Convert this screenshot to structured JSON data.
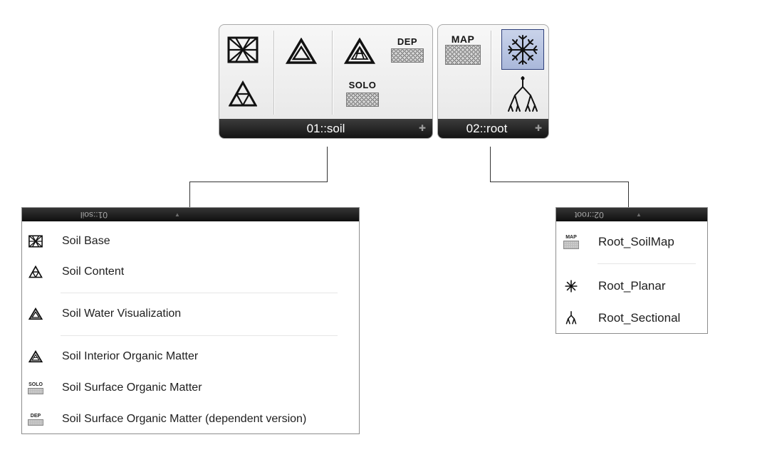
{
  "toolbar": {
    "soil_tab": {
      "title": "01::soil",
      "arrow": "✚",
      "labels": {
        "dep": "DEP",
        "solo": "SOLO"
      }
    },
    "root_tab": {
      "title": "02::root",
      "arrow": "✚",
      "labels": {
        "map": "MAP"
      }
    }
  },
  "soil_menu": {
    "header": "01::soil",
    "header_arrow": "▲",
    "items": [
      {
        "label": "Soil Base",
        "icon": "soil-base-icon"
      },
      {
        "label": "Soil Content",
        "icon": "soil-content-icon"
      },
      {
        "label": "Soil Water Visualization",
        "icon": "soil-water-icon"
      },
      {
        "label": "Soil Interior Organic Matter",
        "icon": "soil-interior-icon"
      },
      {
        "label": "Soil Surface Organic Matter",
        "icon": "solo-icon",
        "icon_text": "SOLO"
      },
      {
        "label": "Soil Surface Organic Matter (dependent version)",
        "icon": "dep-icon",
        "icon_text": "DEP"
      }
    ]
  },
  "root_menu": {
    "header": "02::root",
    "header_arrow": "▲",
    "items": [
      {
        "label": "Root_SoilMap",
        "icon": "map-icon",
        "icon_text": "MAP"
      },
      {
        "label": "Root_Planar",
        "icon": "planar-root-icon"
      },
      {
        "label": "Root_Sectional",
        "icon": "sectional-root-icon"
      }
    ]
  },
  "colors": {
    "footer_bg": "#1c1c1c",
    "selected_bg": "#b4c1df",
    "selected_border": "#2d3f7a"
  }
}
